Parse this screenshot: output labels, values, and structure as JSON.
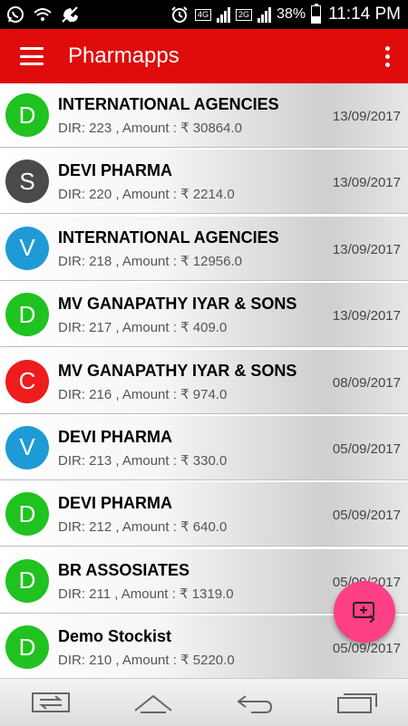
{
  "status_bar": {
    "battery": "38%",
    "time": "11:14 PM",
    "network_1": "4G",
    "network_2": "2G",
    "icons": [
      "whatsapp-icon",
      "wifi-icon",
      "missed-call-icon",
      "alarm-icon",
      "signal-icon",
      "battery-icon"
    ]
  },
  "app_bar": {
    "title": "Pharmapps",
    "menu_icon": "menu-icon",
    "more_icon": "more-vert-icon",
    "color": "#e00b0b"
  },
  "list": {
    "items": [
      {
        "initial": "D",
        "color": "#1fc21f",
        "name": "INTERNATIONAL AGENCIES",
        "sub": "DIR: 223 , Amount : ₹ 30864.0",
        "date": "13/09/2017"
      },
      {
        "initial": "S",
        "color": "#4a4a4a",
        "name": "DEVI PHARMA",
        "sub": "DIR: 220 , Amount : ₹ 2214.0",
        "date": "13/09/2017"
      },
      {
        "initial": "V",
        "color": "#1e9ad6",
        "name": "INTERNATIONAL AGENCIES",
        "sub": "DIR: 218 , Amount : ₹ 12956.0",
        "date": "13/09/2017"
      },
      {
        "initial": "D",
        "color": "#1fc21f",
        "name": "MV GANAPATHY IYAR & SONS",
        "sub": "DIR: 217 , Amount : ₹ 409.0",
        "date": "13/09/2017"
      },
      {
        "initial": "C",
        "color": "#ee1c1c",
        "name": "MV GANAPATHY IYAR & SONS",
        "sub": "DIR: 216 , Amount : ₹ 974.0",
        "date": "08/09/2017"
      },
      {
        "initial": "V",
        "color": "#1e9ad6",
        "name": "DEVI PHARMA",
        "sub": "DIR: 213 , Amount : ₹ 330.0",
        "date": "05/09/2017"
      },
      {
        "initial": "D",
        "color": "#1fc21f",
        "name": "DEVI PHARMA",
        "sub": "DIR: 212 , Amount : ₹ 640.0",
        "date": "05/09/2017"
      },
      {
        "initial": "D",
        "color": "#1fc21f",
        "name": "BR ASSOSIATES",
        "sub": "DIR: 211 , Amount : ₹ 1319.0",
        "date": "05/09/2017"
      },
      {
        "initial": "D",
        "color": "#1fc21f",
        "name": "Demo Stockist",
        "sub": "DIR: 210 , Amount : ₹ 5220.0",
        "date": "05/09/2017"
      }
    ]
  },
  "fab": {
    "icon": "add-to-queue-icon",
    "color": "#ff3f86"
  },
  "nav_bar": {
    "icons": [
      "switch-sim-icon",
      "home-icon",
      "back-icon",
      "recent-apps-icon"
    ]
  }
}
